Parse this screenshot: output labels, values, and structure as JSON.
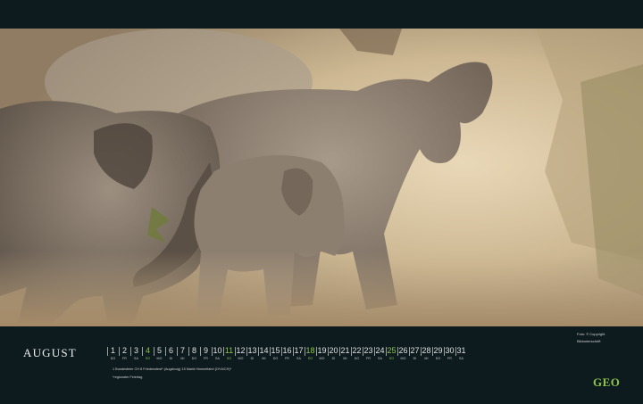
{
  "month": "AUGUST",
  "days": [
    {
      "n": "1",
      "wd": "DO",
      "green": false
    },
    {
      "n": "2",
      "wd": "FR",
      "green": false
    },
    {
      "n": "3",
      "wd": "SA",
      "green": false
    },
    {
      "n": "4",
      "wd": "SO",
      "green": true
    },
    {
      "n": "5",
      "wd": "MO",
      "green": false
    },
    {
      "n": "6",
      "wd": "DI",
      "green": false
    },
    {
      "n": "7",
      "wd": "MI",
      "green": false
    },
    {
      "n": "8",
      "wd": "DO",
      "green": false
    },
    {
      "n": "9",
      "wd": "FR",
      "green": false
    },
    {
      "n": "10",
      "wd": "SA",
      "green": false
    },
    {
      "n": "11",
      "wd": "SO",
      "green": true
    },
    {
      "n": "12",
      "wd": "MO",
      "green": false
    },
    {
      "n": "13",
      "wd": "DI",
      "green": false
    },
    {
      "n": "14",
      "wd": "MI",
      "green": false
    },
    {
      "n": "15",
      "wd": "DO",
      "green": false
    },
    {
      "n": "16",
      "wd": "FR",
      "green": false
    },
    {
      "n": "17",
      "wd": "SA",
      "green": false
    },
    {
      "n": "18",
      "wd": "SO",
      "green": true
    },
    {
      "n": "19",
      "wd": "MO",
      "green": false
    },
    {
      "n": "20",
      "wd": "DI",
      "green": false
    },
    {
      "n": "21",
      "wd": "MI",
      "green": false
    },
    {
      "n": "22",
      "wd": "DO",
      "green": false
    },
    {
      "n": "23",
      "wd": "FR",
      "green": false
    },
    {
      "n": "24",
      "wd": "SA",
      "green": false
    },
    {
      "n": "25",
      "wd": "SO",
      "green": true
    },
    {
      "n": "26",
      "wd": "MO",
      "green": false
    },
    {
      "n": "27",
      "wd": "DI",
      "green": false
    },
    {
      "n": "28",
      "wd": "MI",
      "green": false
    },
    {
      "n": "29",
      "wd": "DO",
      "green": false
    },
    {
      "n": "30",
      "wd": "FR",
      "green": false
    },
    {
      "n": "31",
      "wd": "SA",
      "green": false
    }
  ],
  "holidays_line1": "1 Bundesfeier CH   8 Friedensfest* (Augsburg)   15 Mariä Himmelfahrt (D*/A/CH)*",
  "holidays_line2": "*regionaler Feiertag",
  "credit_line1": "Foto: © Copyright",
  "credit_line2": "Bildunterschrift",
  "logo": "GEO",
  "colors": {
    "background": "#0d1b1f",
    "accent_green": "#8cc44a",
    "dust": "#c9b89a"
  }
}
